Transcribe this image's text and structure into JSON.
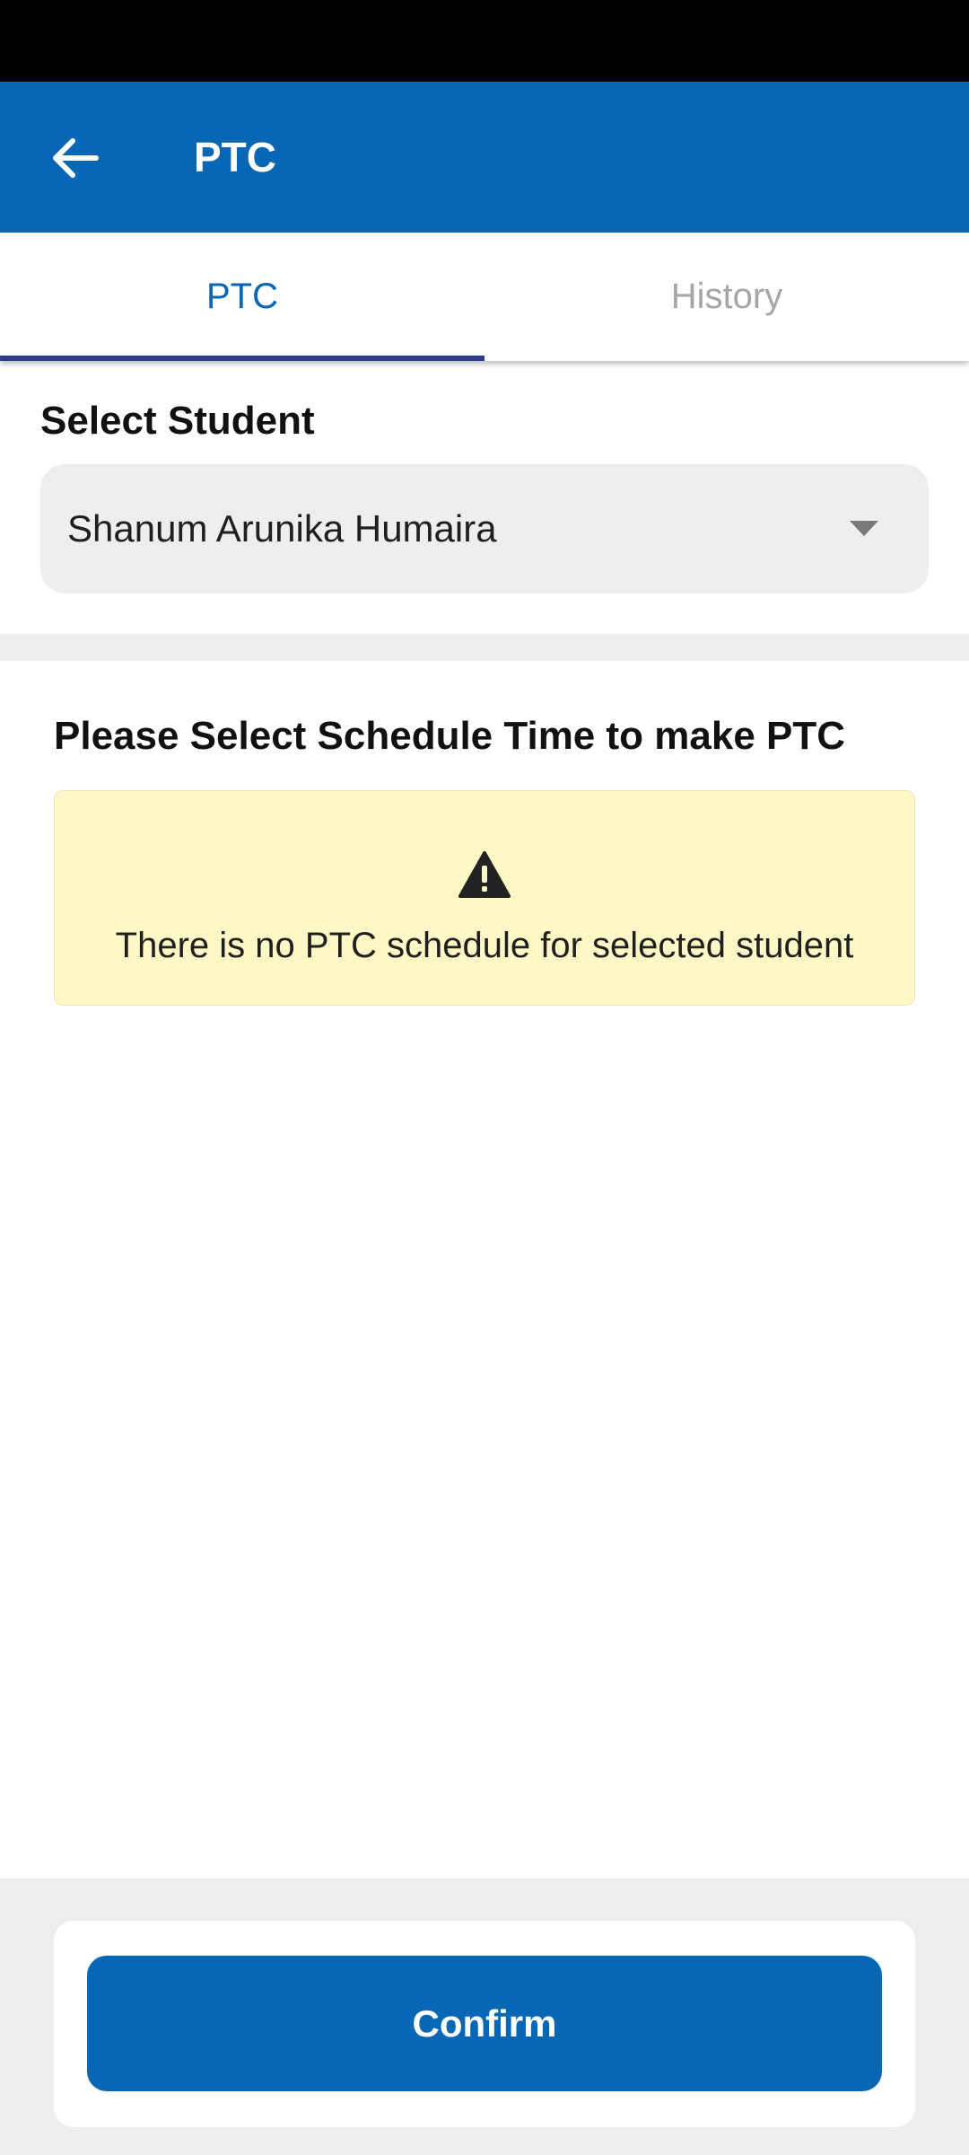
{
  "app_bar": {
    "title": "PTC",
    "back_icon": "arrow-left-icon",
    "background_color": "#0767b4"
  },
  "tabs": [
    {
      "label": "PTC",
      "active": true
    },
    {
      "label": "History",
      "active": false
    }
  ],
  "student_select": {
    "label": "Select Student",
    "selected_value": "Shanum Arunika Humaira",
    "caret_icon": "caret-down-icon"
  },
  "schedule": {
    "heading": "Please Select Schedule Time to make PTC",
    "warning_icon": "warning-triangle-icon",
    "empty_message": "There is no PTC schedule for selected student",
    "warning_background": "#fef8c6"
  },
  "footer": {
    "confirm_label": "Confirm"
  }
}
